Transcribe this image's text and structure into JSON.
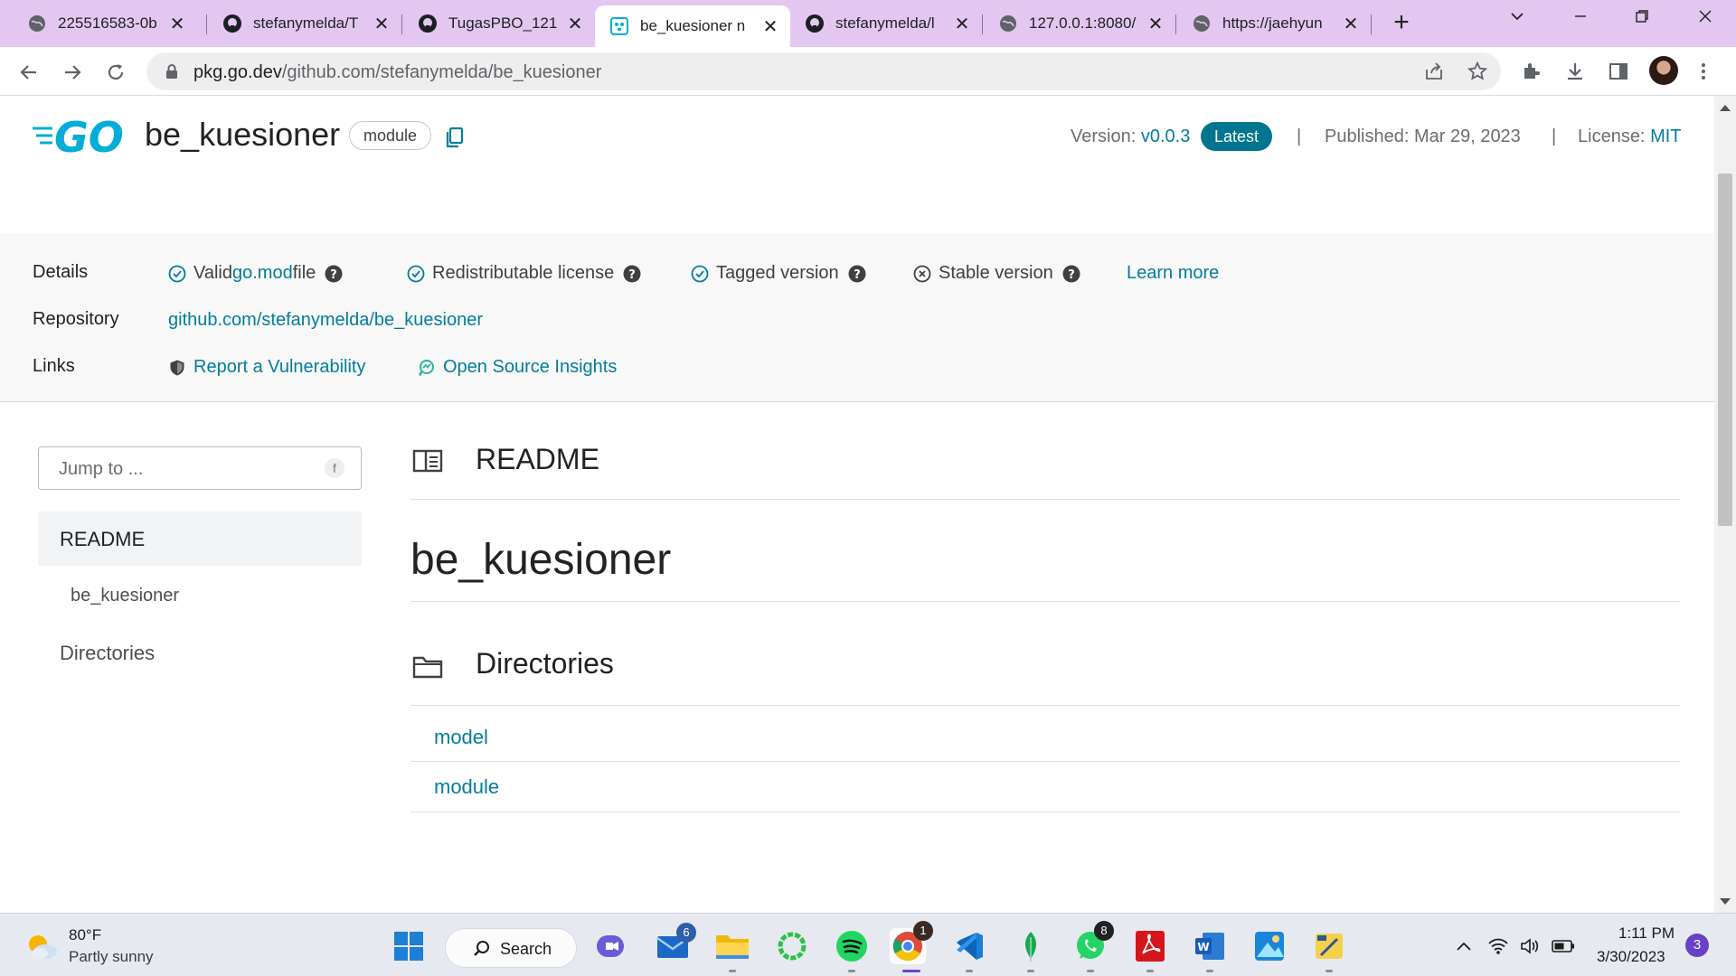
{
  "browser": {
    "tabs": [
      {
        "title": "225516583-0b",
        "icon": "globe-icon"
      },
      {
        "title": "stefanymelda/T",
        "icon": "github-icon"
      },
      {
        "title": "TugasPBO_121",
        "icon": "github-icon"
      },
      {
        "title": "be_kuesioner n",
        "icon": "gopher-icon",
        "active": true
      },
      {
        "title": "stefanymelda/l",
        "icon": "github-icon"
      },
      {
        "title": "127.0.0.1:8080/",
        "icon": "globe-icon"
      },
      {
        "title": "https://jaehyun",
        "icon": "globe-icon"
      }
    ],
    "new_tab_label": "+",
    "close_glyph": "✕",
    "url_host": "pkg.go.dev",
    "url_path": "/github.com/stefanymelda/be_kuesioner"
  },
  "header": {
    "package_name": "be_kuesioner",
    "module_label": "module",
    "version_label": "Version:",
    "version_value": "v0.0.3",
    "latest_badge": "Latest",
    "separator": "|",
    "published_label": "Published: Mar 29, 2023",
    "license_label": "License:",
    "license_value": "MIT"
  },
  "details": {
    "details_label": "Details",
    "valid_go_mod_prefix": "Valid ",
    "valid_go_mod_link": "go.mod",
    "valid_go_mod_suffix": " file",
    "redistributable": "Redistributable license",
    "tagged": "Tagged version",
    "stable": "Stable version",
    "learn_more": "Learn more",
    "repository_label": "Repository",
    "repository_value": "github.com/stefanymelda/be_kuesioner",
    "links_label": "Links",
    "report_vuln": "Report a Vulnerability",
    "open_source_insights": "Open Source Insights"
  },
  "sidebar": {
    "jump_placeholder": "Jump to ...",
    "jump_key": "f",
    "items": [
      {
        "label": "README"
      },
      {
        "label": "be_kuesioner"
      },
      {
        "label": "Directories"
      }
    ]
  },
  "main": {
    "readme_title": "README",
    "readme_heading": "be_kuesioner",
    "directories_title": "Directories",
    "directories": [
      "model",
      "module"
    ]
  },
  "taskbar": {
    "weather_temp": "80°F",
    "weather_desc": "Partly sunny",
    "search_label": "Search",
    "mail_badge": "6",
    "chrome_badge": "1",
    "whatsapp_badge": "8",
    "time": "1:11 PM",
    "date": "3/30/2023",
    "notifications": "3"
  },
  "colors": {
    "tabstrip": "#e3c7f0",
    "go_blue": "#00add8",
    "link": "#007d9c",
    "latest_badge": "#00758f"
  }
}
